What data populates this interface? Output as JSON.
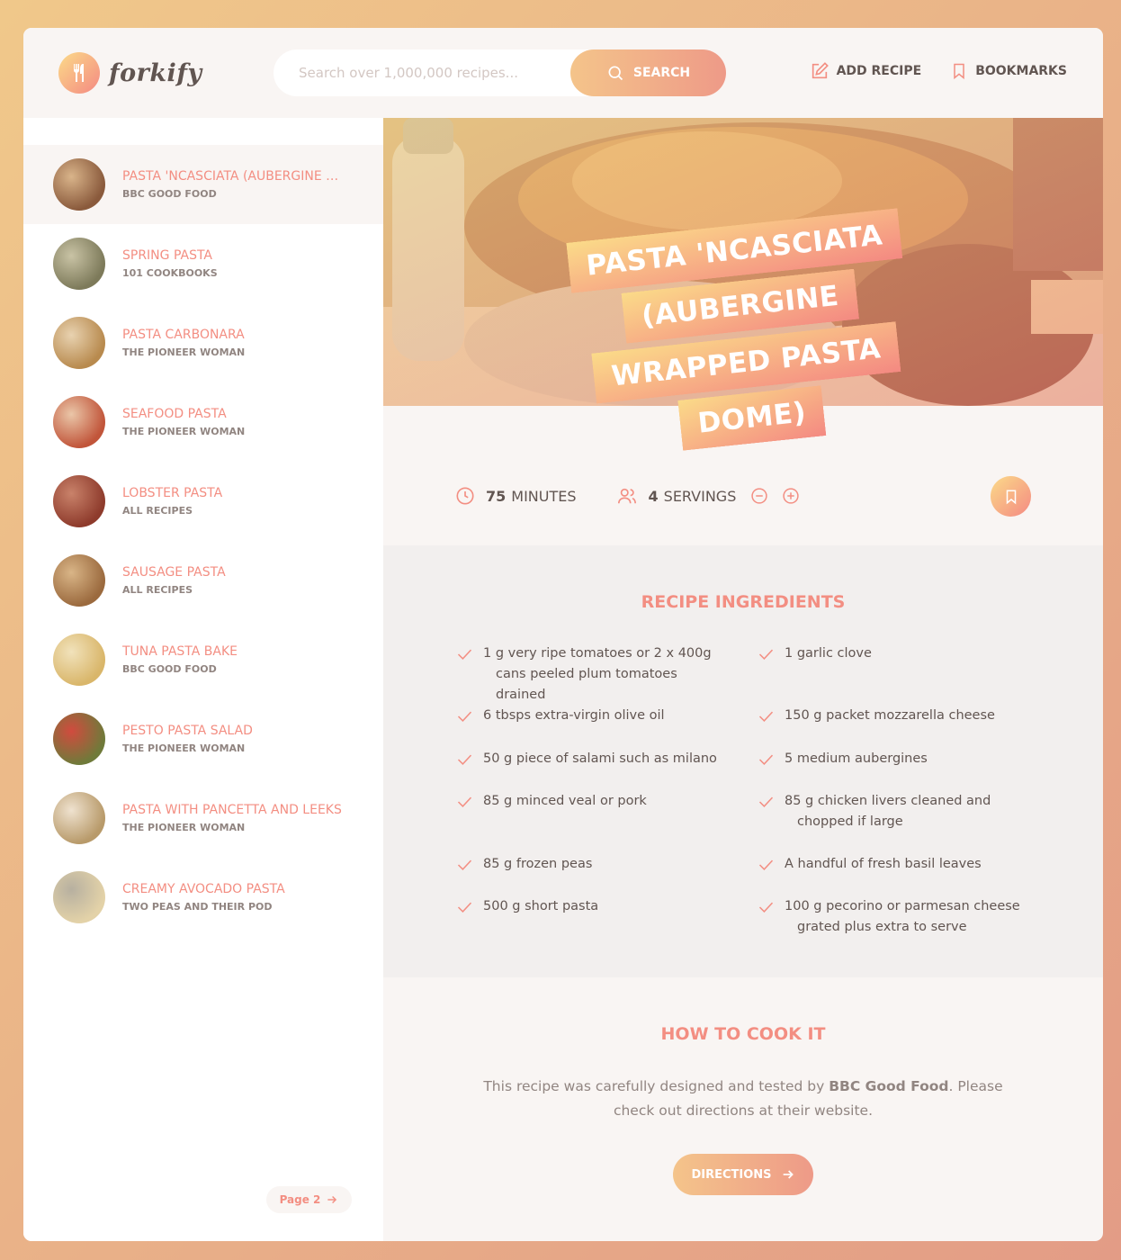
{
  "header": {
    "logo_text": "forkify",
    "search_placeholder": "Search over 1,000,000 recipes...",
    "search_button": "Search",
    "nav": {
      "add_recipe": "Add recipe",
      "bookmarks": "Bookmarks"
    }
  },
  "results": [
    {
      "title": "Pasta 'Ncasciata (Aubergine Wrapped Pasta Dome)",
      "publisher": "BBC Good Food",
      "active": true
    },
    {
      "title": "Spring Pasta",
      "publisher": "101 Cookbooks"
    },
    {
      "title": "Pasta Carbonara",
      "publisher": "The Pioneer Woman"
    },
    {
      "title": "Seafood Pasta",
      "publisher": "The Pioneer Woman"
    },
    {
      "title": "Lobster Pasta",
      "publisher": "All Recipes"
    },
    {
      "title": "Sausage Pasta",
      "publisher": "All Recipes"
    },
    {
      "title": "Tuna Pasta Bake",
      "publisher": "BBC Good Food"
    },
    {
      "title": "Pesto Pasta Salad",
      "publisher": "The Pioneer Woman"
    },
    {
      "title": "Pasta with Pancetta and Leeks",
      "publisher": "The Pioneer Woman"
    },
    {
      "title": "Creamy Avocado Pasta",
      "publisher": "Two Peas and Their Pod"
    }
  ],
  "pagination": {
    "next": "Page 2"
  },
  "recipe": {
    "title": "Pasta 'Ncasciata (Aubergine Wrapped Pasta Dome)",
    "cooking_time": "75",
    "cooking_time_unit": "minutes",
    "servings": "4",
    "servings_unit": "servings"
  },
  "ingredients": {
    "heading": "Recipe ingredients",
    "items": [
      {
        "line1": "1 g very ripe tomatoes or 2 x 400g",
        "line2": "cans peeled plum tomatoes drained"
      },
      {
        "line1": "1 garlic clove",
        "line2": ""
      },
      {
        "line1": "6 tbsps extra-virgin olive oil",
        "line2": ""
      },
      {
        "line1": "150 g packet mozzarella cheese",
        "line2": ""
      },
      {
        "line1": "50 g piece of salami such as milano",
        "line2": ""
      },
      {
        "line1": "5 medium aubergines",
        "line2": ""
      },
      {
        "line1": "85 g minced veal or pork",
        "line2": ""
      },
      {
        "line1": "85 g chicken livers cleaned and",
        "line2": "chopped if large"
      },
      {
        "line1": "85 g frozen peas",
        "line2": ""
      },
      {
        "line1": " A handful of fresh basil leaves",
        "line2": ""
      },
      {
        "line1": "500 g short pasta",
        "line2": ""
      },
      {
        "line1": "100 g pecorino or parmesan cheese",
        "line2": "grated plus extra to serve"
      }
    ]
  },
  "directions": {
    "heading": "How to cook it",
    "text_before": "This recipe was carefully designed and tested by ",
    "publisher": "BBC Good Food",
    "text_after": ". Please check out directions at their website.",
    "button": "Directions"
  },
  "colors": {
    "accent": "#f38e82",
    "grad_start": "#fbdb89",
    "grad_end": "#f48982",
    "text": "#615551"
  }
}
